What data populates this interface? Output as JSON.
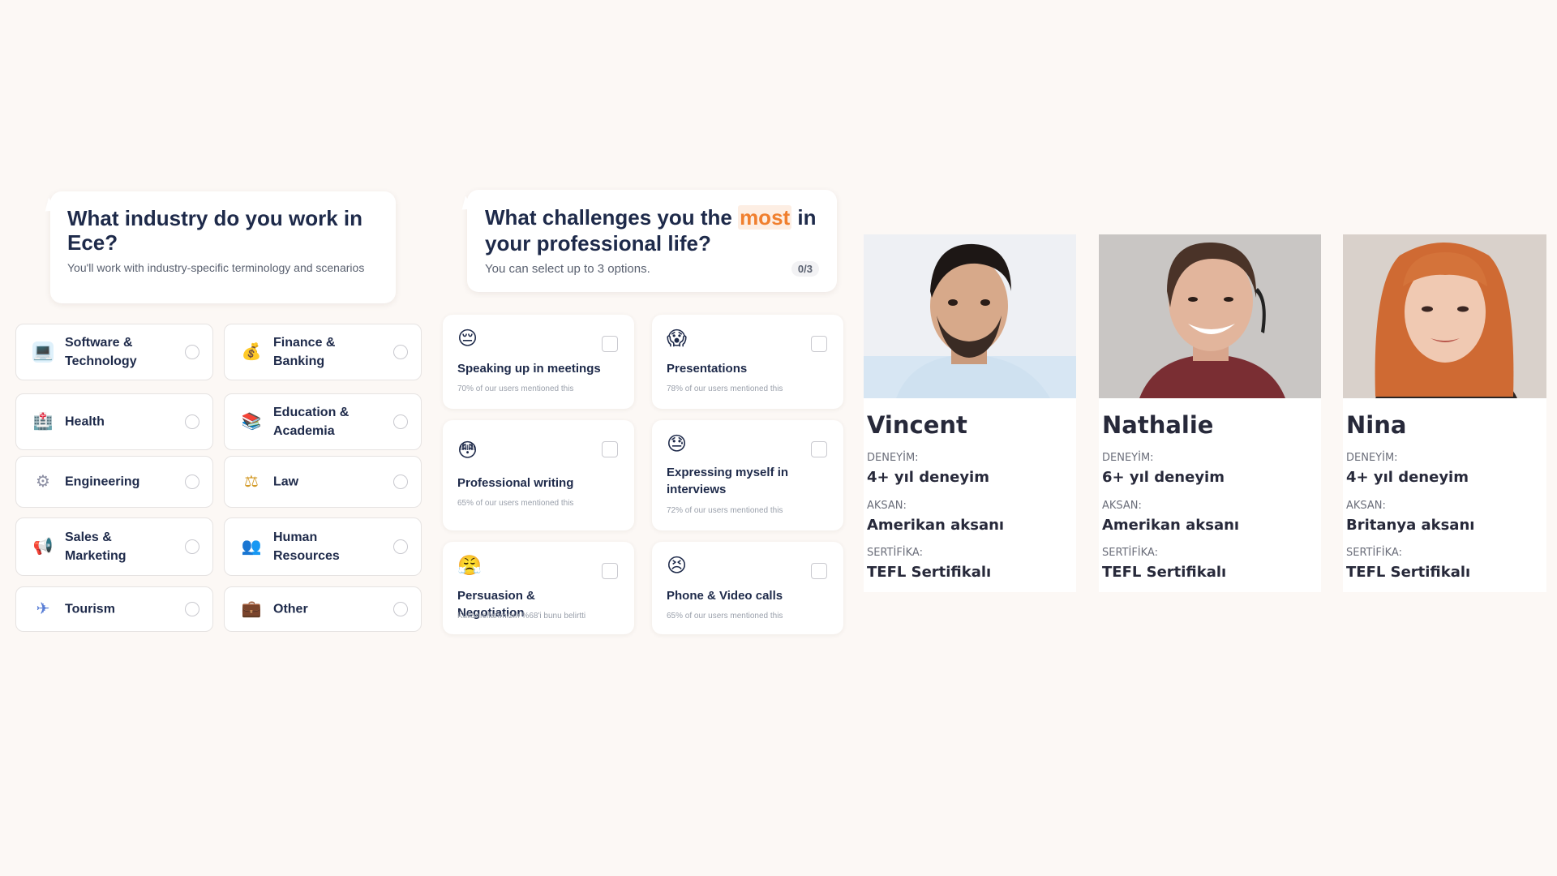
{
  "industry": {
    "title": "What industry do you work in Ece?",
    "subtitle": "You'll work with industry-specific terminology and scenarios",
    "options": [
      {
        "label": "Software & Technology",
        "icon": "laptop-icon",
        "glyph": "💻"
      },
      {
        "label": "Finance & Banking",
        "icon": "money-bag-icon",
        "glyph": "💰"
      },
      {
        "label": "Health",
        "icon": "hospital-icon",
        "glyph": "🏥"
      },
      {
        "label": "Education & Academia",
        "icon": "books-icon",
        "glyph": "📚"
      },
      {
        "label": "Engineering",
        "icon": "gear-icon",
        "glyph": "⚙"
      },
      {
        "label": "Law",
        "icon": "scales-icon",
        "glyph": "⚖"
      },
      {
        "label": "Sales & Marketing",
        "icon": "megaphone-icon",
        "glyph": "📢"
      },
      {
        "label": "Human Resources",
        "icon": "people-icon",
        "glyph": "👥"
      },
      {
        "label": "Tourism",
        "icon": "airplane-icon",
        "glyph": "✈"
      },
      {
        "label": "Other",
        "icon": "briefcase-icon",
        "glyph": "💼"
      }
    ]
  },
  "challenges": {
    "title_pre": "What challenges you the ",
    "title_highlight": "most",
    "title_post": " in your professional life?",
    "subtitle": "You can select up to 3 options.",
    "counter": "0/3",
    "options": [
      {
        "label": "Speaking up in meetings",
        "note": "70% of our users mentioned this",
        "icon": "pensive-face-icon",
        "glyph": "😔"
      },
      {
        "label": "Presentations",
        "note": "78% of our users mentioned this",
        "icon": "screaming-face-icon",
        "glyph": "😱"
      },
      {
        "label": "Professional writing",
        "note": "65% of our users mentioned this",
        "icon": "flushed-face-icon",
        "glyph": "😳"
      },
      {
        "label": "Expressing myself in interviews",
        "note": "72% of our users mentioned this",
        "icon": "sweat-face-icon",
        "glyph": "😓"
      },
      {
        "label": "Persuasion & Negotiation",
        "note": "Kullanıcılarımızın %68'i bunu belirtti",
        "icon": "steam-face-icon",
        "glyph": "😤"
      },
      {
        "label": "Phone & Video calls",
        "note": "65% of our users mentioned this",
        "icon": "confounded-face-icon",
        "glyph": "😣"
      }
    ]
  },
  "tutors": [
    {
      "name": "Vincent",
      "experience_label": "DENEYİM:",
      "experience": "4+ yıl deneyim",
      "accent_label": "AKSAN:",
      "accent": "Amerikan aksanı",
      "cert_label": "SERTİFİKA:",
      "cert": "TEFL Sertifikalı"
    },
    {
      "name": "Nathalie",
      "experience_label": "DENEYİM:",
      "experience": "6+ yıl deneyim",
      "accent_label": "AKSAN:",
      "accent": "Amerikan aksanı",
      "cert_label": "SERTİFİKA:",
      "cert": "TEFL Sertifikalı"
    },
    {
      "name": "Nina",
      "experience_label": "DENEYİM:",
      "experience": "4+ yıl deneyim",
      "accent_label": "AKSAN:",
      "accent": "Britanya aksanı",
      "cert_label": "SERTİFİKA:",
      "cert": "TEFL Sertifikalı"
    }
  ],
  "colors": {
    "background": "#fcf8f5",
    "heading": "#1e2a4a",
    "highlight": "#f07f2e"
  }
}
